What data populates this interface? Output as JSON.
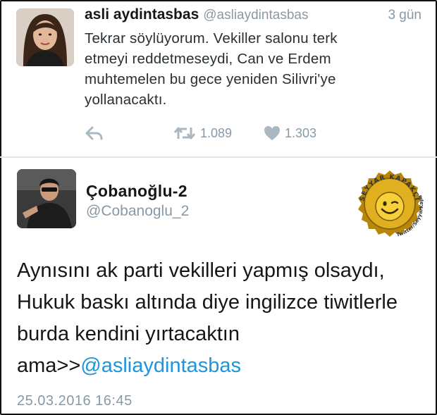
{
  "tweet1": {
    "author_name": "asli aydintasbas",
    "author_handle": "@asliaydintasbas",
    "time": "3 gün",
    "lines": [
      "Tekrar söylüyorum. Vekiller salonu terk",
      "etmeyi reddetmeseydi, Can ve Erdem",
      "muhtemelen bu gece yeniden Silivri'ye",
      "yollanacaktı."
    ],
    "retweet_count": "1.089",
    "like_count": "1.303",
    "icons": {
      "reply": "reply-icon",
      "retweet": "retweet-icon",
      "like": "heart-icon"
    }
  },
  "tweet2": {
    "author_name": "Çobanoğlu-2",
    "author_handle": "@Cobanoglu_2",
    "text_before_mention": "Aynısını ak parti vekilleri yapmış olsaydı, Hukuk baskı altında diye ingilizce tiwitlerle burda kendini yırtacaktın ama>>",
    "mention": "@asliaydintasbas",
    "date": "25.03.2016 16:45"
  },
  "badge": {
    "text_top": "SEYYAR KAPAKÇI",
    "text_bottom": "Twitter/SeyyarKapakci"
  },
  "colors": {
    "link": "#1b95e0",
    "secondary_text": "#8899a6",
    "divider": "#e1e8ed",
    "badge_gold": "#d4a017"
  }
}
